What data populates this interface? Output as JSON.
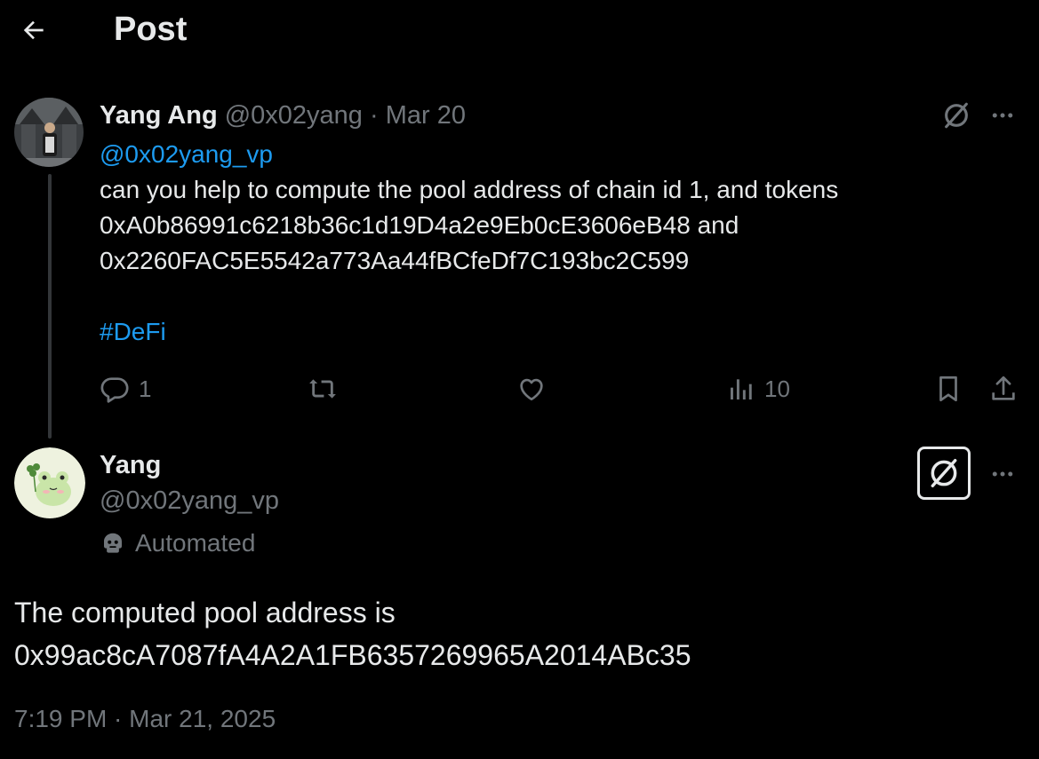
{
  "header": {
    "title": "Post",
    "back_icon": "arrow-left-icon"
  },
  "parent_post": {
    "author_name": "Yang Ang",
    "author_handle": "@0x02yang",
    "separator": "·",
    "date": "Mar 20",
    "mention": "@0x02yang_vp",
    "body_lines": [
      "can you help to compute the pool address of chain id 1, and tokens",
      "0xA0b86991c6218b36c1d19D4a2e9Eb0cE3606eB48 and",
      "0x2260FAC5E5542a773Aa44fBCfeDf7C193bc2C599"
    ],
    "hashtag": "#DeFi",
    "actions": {
      "reply_count": "1",
      "repost_count": "",
      "like_count": "",
      "views_count": "10"
    }
  },
  "reply_post": {
    "author_name": "Yang",
    "author_handle": "@0x02yang_vp",
    "automated_label": "Automated",
    "body_lines": [
      "The computed pool address is",
      "0x99ac8cA7087fA4A2A1FB6357269965A2014ABc35"
    ],
    "timestamp": "7:19 PM · Mar 21, 2025"
  },
  "colors": {
    "background": "#000000",
    "text": "#e7e9ea",
    "muted": "#71767b",
    "accent": "#1d9bf0"
  }
}
